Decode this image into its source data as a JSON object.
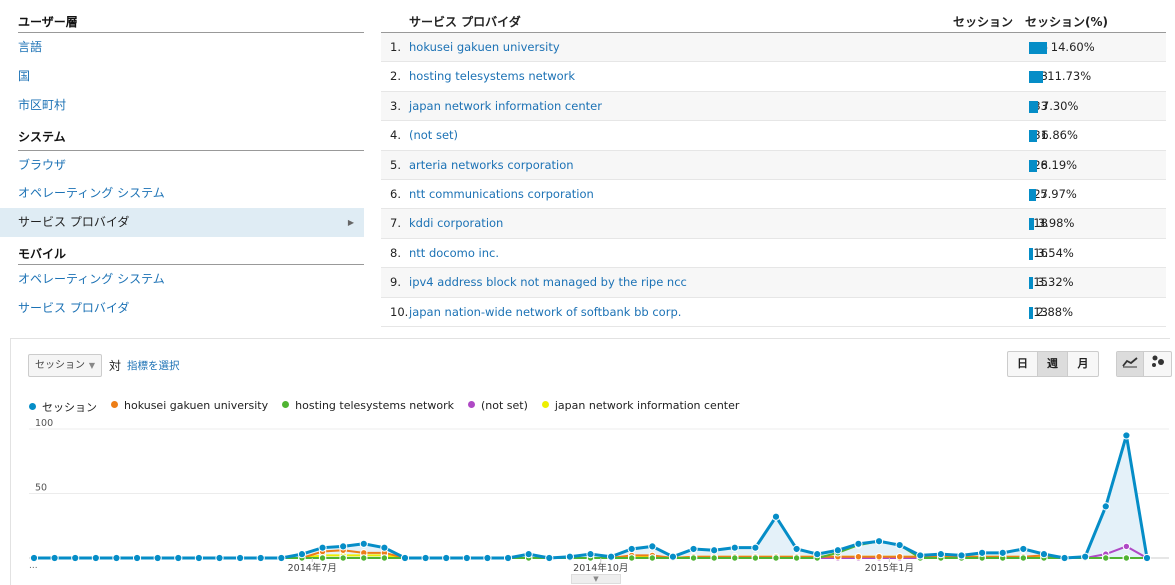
{
  "sidebar": {
    "user_section": "ユーザー層",
    "user_links": [
      "言語",
      "国",
      "市区町村"
    ],
    "system_section": "システム",
    "system_links": [
      "ブラウザ",
      "オペレーティング システム",
      "サービス プロバイダ"
    ],
    "mobile_section": "モバイル",
    "mobile_links": [
      "オペレーティング システム",
      "サービス プロバイダ"
    ]
  },
  "table": {
    "dim_header": "サービス プロバイダ",
    "sess_header": "セッション",
    "pct_header": "セッション(%)",
    "rows": [
      {
        "idx": "1.",
        "name": "hokusei gakuen university",
        "sessions": "66",
        "pct": "14.60%",
        "share": 14.6
      },
      {
        "idx": "2.",
        "name": "hosting telesystems network",
        "sessions": "53",
        "pct": "11.73%",
        "share": 11.73
      },
      {
        "idx": "3.",
        "name": "japan network information center",
        "sessions": "33",
        "pct": "7.30%",
        "share": 7.3
      },
      {
        "idx": "4.",
        "name": "(not set)",
        "sessions": "31",
        "pct": "6.86%",
        "share": 6.86
      },
      {
        "idx": "5.",
        "name": "arteria networks corporation",
        "sessions": "28",
        "pct": "6.19%",
        "share": 6.19
      },
      {
        "idx": "6.",
        "name": "ntt communications corporation",
        "sessions": "27",
        "pct": "5.97%",
        "share": 5.97
      },
      {
        "idx": "7.",
        "name": "kddi corporation",
        "sessions": "18",
        "pct": "3.98%",
        "share": 3.98
      },
      {
        "idx": "8.",
        "name": "ntt docomo inc.",
        "sessions": "16",
        "pct": "3.54%",
        "share": 3.54
      },
      {
        "idx": "9.",
        "name": "ipv4 address block not managed by the ripe ncc",
        "sessions": "15",
        "pct": "3.32%",
        "share": 3.32
      },
      {
        "idx": "10.",
        "name": "japan nation-wide network of softbank bb corp.",
        "sessions": "13",
        "pct": "2.88%",
        "share": 2.88
      }
    ]
  },
  "controls": {
    "metric": "セッション",
    "vs": "対",
    "choose_metric": "指標を選択",
    "periods": [
      "日",
      "週",
      "月"
    ],
    "active_period": "週",
    "views": [
      "line-chart-icon",
      "motion-chart-icon"
    ]
  },
  "colors": {
    "link": "#1c72b5",
    "bar": "#058dc7",
    "sessions": "#058dc7",
    "hokusei": "#ed7e17",
    "hosting": "#50b432",
    "notset": "#af49c5",
    "japan": "#edef00"
  },
  "chart_data": {
    "type": "line",
    "legend": [
      "セッション",
      "hokusei gakuen university",
      "hosting telesystems network",
      "(not set)",
      "japan network information center"
    ],
    "y_ticks": [
      "100",
      "50"
    ],
    "ylim": [
      0,
      100
    ],
    "x_tick_labels": [
      "2014年7月",
      "2014年10月",
      "2015年1月"
    ],
    "x_tick_positions": [
      13.5,
      27.5,
      41.5
    ],
    "ellipsis": "...",
    "series": [
      {
        "name": "セッション",
        "values": [
          0,
          0,
          0,
          0,
          0,
          0,
          0,
          0,
          0,
          0,
          0,
          0,
          0,
          3,
          8,
          9,
          11,
          8,
          0,
          0,
          0,
          0,
          0,
          0,
          3,
          0,
          1,
          3,
          1,
          7,
          9,
          1,
          7,
          6,
          8,
          8,
          32,
          7,
          3,
          6,
          11,
          13,
          10,
          2,
          3,
          2,
          4,
          4,
          7,
          3,
          0,
          1,
          40,
          95,
          0
        ]
      },
      {
        "name": "hokusei gakuen university",
        "values": [
          0,
          0,
          0,
          0,
          0,
          0,
          0,
          0,
          0,
          0,
          0,
          0,
          0,
          0,
          5,
          6,
          4,
          4,
          0,
          0,
          0,
          0,
          0,
          0,
          0,
          0,
          0,
          0,
          0,
          2,
          2,
          0,
          1,
          1,
          1,
          1,
          1,
          1,
          1,
          1,
          1,
          1,
          1,
          1,
          1,
          1,
          1,
          1,
          1,
          2,
          0,
          0,
          0,
          0,
          0
        ]
      },
      {
        "name": "hosting telesystems network",
        "values": [
          0,
          0,
          0,
          0,
          0,
          0,
          0,
          0,
          0,
          0,
          0,
          0,
          0,
          0,
          0,
          0,
          0,
          0,
          0,
          0,
          0,
          0,
          0,
          0,
          0,
          0,
          0,
          0,
          0,
          0,
          0,
          0,
          0,
          0,
          0,
          0,
          0,
          0,
          0,
          4,
          10,
          13,
          10,
          0,
          0,
          0,
          0,
          0,
          0,
          0,
          0,
          0,
          0,
          0,
          0
        ]
      },
      {
        "name": "(not set)",
        "values": [
          0,
          0,
          0,
          0,
          0,
          0,
          0,
          0,
          0,
          0,
          0,
          0,
          0,
          0,
          0,
          0,
          0,
          0,
          0,
          0,
          0,
          0,
          0,
          0,
          0,
          0,
          0,
          0,
          0,
          0,
          0,
          0,
          0,
          0,
          0,
          0,
          0,
          0,
          0,
          0,
          0,
          0,
          0,
          0,
          0,
          0,
          0,
          0,
          0,
          0,
          0,
          0,
          3,
          9,
          0
        ]
      },
      {
        "name": "japan network information center",
        "values": [
          0,
          0,
          0,
          0,
          0,
          0,
          0,
          0,
          0,
          0,
          0,
          0,
          0,
          0,
          2,
          2,
          2,
          2,
          0,
          0,
          0,
          0,
          0,
          0,
          0,
          0,
          0,
          0,
          0,
          1,
          1,
          0,
          1,
          1,
          1,
          1,
          1,
          1,
          1,
          1,
          1,
          1,
          1,
          1,
          1,
          1,
          1,
          1,
          1,
          1,
          0,
          0,
          0,
          0,
          0
        ]
      }
    ]
  }
}
